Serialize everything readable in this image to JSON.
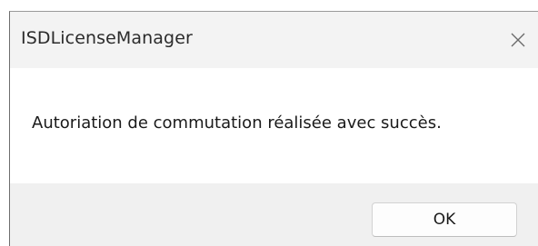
{
  "window": {
    "title": "ISDLicenseManager",
    "close_icon": "close-icon"
  },
  "content": {
    "message": "Autoriation de commutation réalisée avec succès."
  },
  "footer": {
    "ok_label": "OK"
  }
}
